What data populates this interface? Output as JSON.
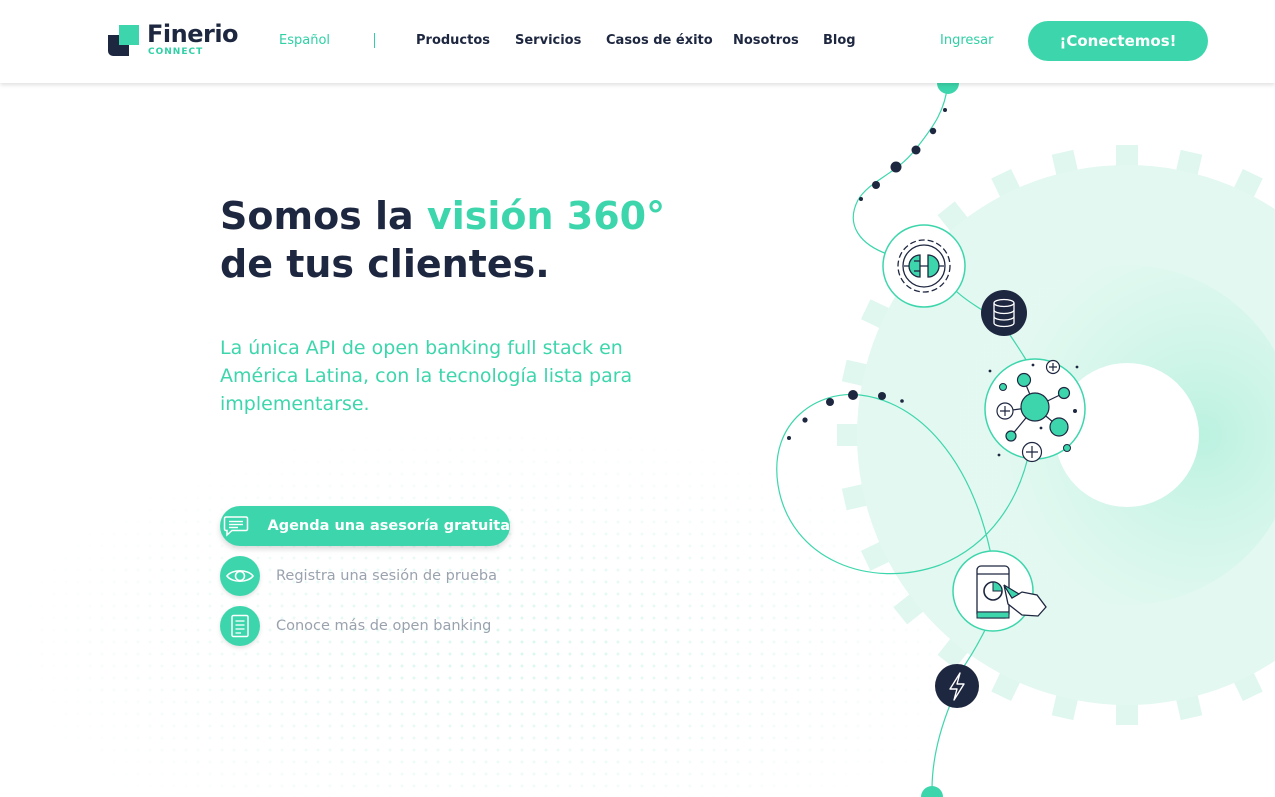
{
  "header": {
    "logo": {
      "name": "Finerio",
      "sub": "CONNECT"
    },
    "language": "Español",
    "nav": [
      "Productos",
      "Servicios",
      "Casos de éxito",
      "Nosotros",
      "Blog"
    ],
    "login": "Ingresar",
    "cta": "¡Conectemos!"
  },
  "hero": {
    "title_line1_part1": "Somos la ",
    "title_line1_accent": "visión 360°",
    "title_line2": "de tus clientes.",
    "subtitle": "La única API de open banking full stack en América Latina, con la tecnología lista para implementarse."
  },
  "actions": [
    {
      "label": "Agenda una asesoría gratuita",
      "icon": "chat-icon"
    },
    {
      "label": "Registra una sesión de prueba",
      "icon": "eye-icon"
    },
    {
      "label": "Conoce más de open banking",
      "icon": "document-icon"
    }
  ],
  "illustration": {
    "nodes": [
      "gear-plug-icon",
      "database-icon",
      "network-icon",
      "phone-touch-icon",
      "lightning-icon"
    ]
  },
  "colors": {
    "accent": "#3dd6ac",
    "navy": "#1e2740",
    "muted": "#9aa2ae",
    "gear": "#d6f6ec"
  }
}
